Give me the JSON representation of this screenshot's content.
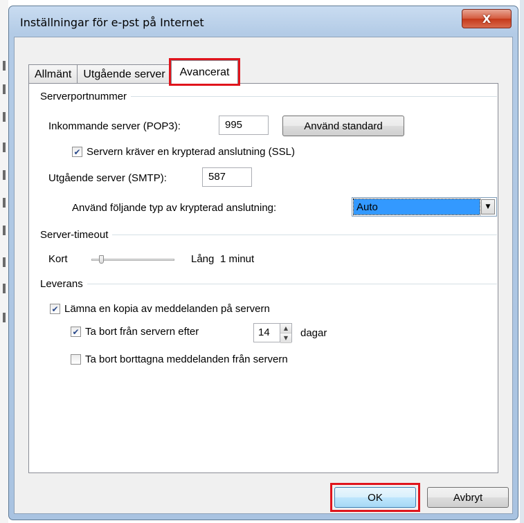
{
  "window": {
    "title": "Inställningar för e-pst på Internet",
    "close_symbol": "X"
  },
  "tabs": [
    {
      "label": "Allmänt",
      "active": false
    },
    {
      "label": "Utgående server",
      "active": false
    },
    {
      "label": "Avancerat",
      "active": true
    }
  ],
  "server_ports": {
    "header": "Serverportnummer",
    "incoming_label": "Inkommande server (POP3):",
    "incoming_value": "995",
    "use_default_button": "Använd standard",
    "ssl_checkbox": {
      "label": "Servern kräver en krypterad anslutning (SSL)",
      "checked": true
    },
    "outgoing_label": "Utgående server (SMTP):",
    "outgoing_value": "587",
    "encryption_label": "Använd följande typ av krypterad anslutning:",
    "encryption_value": "Auto"
  },
  "timeout": {
    "header": "Server-timeout",
    "short_label": "Kort",
    "long_label": "Lång",
    "value_text": "1 minut",
    "slider_fraction": 0.1
  },
  "delivery": {
    "header": "Leverans",
    "leave_copy": {
      "label": "Lämna en kopia av meddelanden på servern",
      "checked": true
    },
    "remove_after": {
      "label": "Ta bort från servern efter",
      "checked": true
    },
    "days_value": "14",
    "days_unit": "dagar",
    "remove_deleted": {
      "label": "Ta bort borttagna meddelanden från servern",
      "checked": false
    }
  },
  "footer": {
    "ok_label": "OK",
    "cancel_label": "Avbryt"
  },
  "colors": {
    "highlight_red": "#e0141c",
    "selection_blue": "#3399ff",
    "close_red": "#c5391a"
  }
}
